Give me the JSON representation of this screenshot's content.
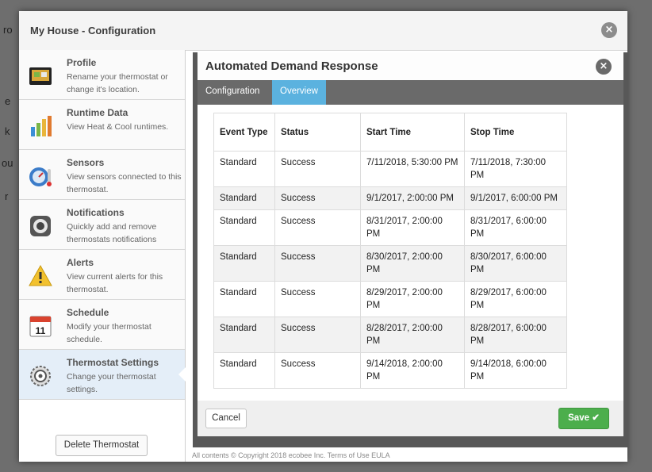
{
  "background": {
    "fragments": [
      "ro",
      "e",
      "k",
      "ou",
      "r"
    ],
    "footer_text": "All contents © Copyright 2018 ecobee Inc.  Terms of Use  EULA"
  },
  "window": {
    "title": "My House - Configuration",
    "close_icon": "close-icon"
  },
  "sidebar": {
    "items": [
      {
        "title": "Profile",
        "description": "Rename your thermostat or change it's location.",
        "icon": "thermostat-icon"
      },
      {
        "title": "Runtime Data",
        "description": "View Heat & Cool runtimes.",
        "icon": "bar-chart-icon"
      },
      {
        "title": "Sensors",
        "description": "View sensors connected to this thermostat.",
        "icon": "sensor-gauge-icon"
      },
      {
        "title": "Notifications",
        "description": "Quickly add and remove thermostats notifications",
        "icon": "notification-icon"
      },
      {
        "title": "Alerts",
        "description": "View current alerts for this thermostat.",
        "icon": "warning-icon"
      },
      {
        "title": "Schedule",
        "description": "Modify your thermostat schedule.",
        "icon": "calendar-icon"
      },
      {
        "title": "Thermostat Settings",
        "description": "Change your thermostat settings.",
        "icon": "settings-gear-icon"
      }
    ],
    "calendar_day": "11",
    "delete_label": "Delete Thermostat"
  },
  "dialog": {
    "title": "Automated Demand Response",
    "tabs": [
      {
        "label": "Configuration",
        "active": false
      },
      {
        "label": "Overview",
        "active": true
      }
    ],
    "table": {
      "headers": [
        "Event Type",
        "Status",
        "Start Time",
        "Stop Time"
      ],
      "rows": [
        [
          "Standard",
          "Success",
          "7/11/2018, 5:30:00 PM",
          "7/11/2018, 7:30:00 PM"
        ],
        [
          "Standard",
          "Success",
          "9/1/2017, 2:00:00 PM",
          "9/1/2017, 6:00:00 PM"
        ],
        [
          "Standard",
          "Success",
          "8/31/2017, 2:00:00 PM",
          "8/31/2017, 6:00:00 PM"
        ],
        [
          "Standard",
          "Success",
          "8/30/2017, 2:00:00 PM",
          "8/30/2017, 6:00:00 PM"
        ],
        [
          "Standard",
          "Success",
          "8/29/2017, 2:00:00 PM",
          "8/29/2017, 6:00:00 PM"
        ],
        [
          "Standard",
          "Success",
          "8/28/2017, 2:00:00 PM",
          "8/28/2017, 6:00:00 PM"
        ],
        [
          "Standard",
          "Success",
          "9/14/2018, 2:00:00 PM",
          "9/14/2018, 6:00:00 PM"
        ]
      ]
    },
    "cancel_label": "Cancel",
    "save_label": "Save ✔",
    "colors": {
      "accent": "#5bb2df",
      "save": "#4cae4c"
    }
  }
}
